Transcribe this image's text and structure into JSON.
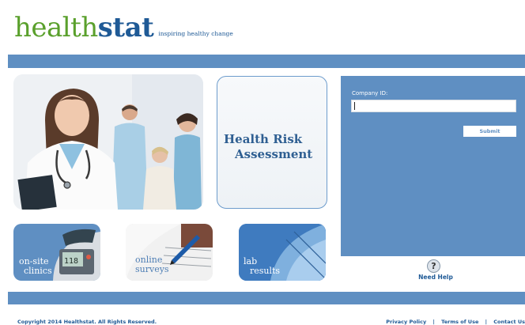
{
  "brand": {
    "name_part1": "health",
    "name_part2": "stat",
    "tagline": "inspiring healthy change",
    "colors": {
      "green": "#5aa02c",
      "blue": "#1f5a96",
      "band": "#5f8fc2"
    }
  },
  "hra": {
    "line1": "Health Risk",
    "line2": "Assessment"
  },
  "login": {
    "company_label": "Company ID:",
    "company_value": "",
    "submit_label": "Submit"
  },
  "help": {
    "icon": "?",
    "label": "Need Help"
  },
  "tiles": [
    {
      "line1": "on-site",
      "line2": "clinics"
    },
    {
      "line1": "online",
      "line2": "surveys"
    },
    {
      "line1": "lab",
      "line2": "results"
    }
  ],
  "footer": {
    "copyright": "Copyright 2014 Healthstat. All Rights Reserved.",
    "links": [
      "Privacy Policy",
      "Terms of Use",
      "Contact Us"
    ],
    "separator": "|"
  }
}
